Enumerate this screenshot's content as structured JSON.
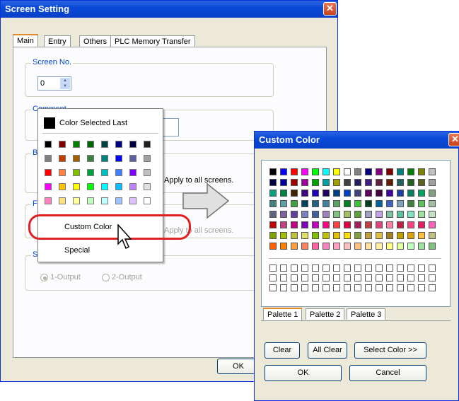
{
  "screen_setting": {
    "title": "Screen Setting",
    "close_glyph": "✕",
    "tabs": [
      "Main",
      "Entry",
      "Others",
      "PLC Memory Transfer"
    ],
    "screen_no": {
      "label": "Screen No.",
      "value": "0"
    },
    "comment": {
      "label": "Comment"
    },
    "group_b_letter": "B",
    "group_f_letter": "F",
    "group_s_letter": "S",
    "apply_all_1": "Apply to all screens.",
    "apply_all_2": "Apply to all screens.",
    "output_1": "1-Output",
    "output_2": "2-Output",
    "ok_label": "OK"
  },
  "color_menu": {
    "last_label": "Color Selected Last",
    "custom_label": "Custom Color",
    "special_label": "Special",
    "swatches": [
      [
        "#000000",
        "#800000",
        "#008000",
        "#006400",
        "#004040",
        "#000080",
        "#000040",
        "#202020"
      ],
      [
        "#808080",
        "#c04000",
        "#a06000",
        "#408040",
        "#008080",
        "#0000ff",
        "#6060a0",
        "#a0a0a0"
      ],
      [
        "#ff0000",
        "#ff8040",
        "#80c000",
        "#00a040",
        "#00c0c0",
        "#4080ff",
        "#8000ff",
        "#c0c0c0"
      ],
      [
        "#ff00ff",
        "#ffc000",
        "#ffff00",
        "#00ff00",
        "#00ffff",
        "#00c0ff",
        "#c080ff",
        "#e0e0e0"
      ],
      [
        "#ff80c0",
        "#ffe080",
        "#ffffa0",
        "#c0ffc0",
        "#c0ffff",
        "#a0c0ff",
        "#e0c0ff",
        "#ffffff"
      ]
    ]
  },
  "custom_color": {
    "title": "Custom Color",
    "close_glyph": "✕",
    "palette_rows": [
      [
        "#000000",
        "#0000ff",
        "#ff0000",
        "#ff00ff",
        "#00ff00",
        "#00ffff",
        "#ffff00",
        "#ffffff",
        "#808080",
        "#000080",
        "#800080",
        "#800000",
        "#008080",
        "#008000",
        "#808000",
        "#c0c0c0"
      ],
      [
        "#000040",
        "#0000a0",
        "#a00000",
        "#a000a0",
        "#00a000",
        "#00a0a0",
        "#a0a000",
        "#404040",
        "#202060",
        "#402080",
        "#602040",
        "#602000",
        "#206060",
        "#206020",
        "#606020",
        "#a0a0a0"
      ],
      [
        "#00a080",
        "#008040",
        "#402000",
        "#400080",
        "#2000c0",
        "#200060",
        "#004080",
        "#0040c0",
        "#404080",
        "#600060",
        "#400040",
        "#4000a0",
        "#2040a0",
        "#008060",
        "#00a060",
        "#80a080"
      ],
      [
        "#408080",
        "#60a0a0",
        "#40a040",
        "#004060",
        "#206080",
        "#4080a0",
        "#60a060",
        "#008020",
        "#40c040",
        "#004020",
        "#0060a0",
        "#4060c0",
        "#80a0c0",
        "#408040",
        "#60c060",
        "#a0c0a0"
      ],
      [
        "#606080",
        "#8060a0",
        "#6040a0",
        "#8080c0",
        "#4060a0",
        "#a080c0",
        "#80c080",
        "#a0c060",
        "#60a040",
        "#a0a0c0",
        "#c0a0e0",
        "#80c0a0",
        "#60c0a0",
        "#80e0c0",
        "#a0e0a0",
        "#c0e0c0"
      ],
      [
        "#c00000",
        "#c04080",
        "#c00080",
        "#8000c0",
        "#c000c0",
        "#ff0080",
        "#ff4040",
        "#e00040",
        "#a02060",
        "#c04040",
        "#e04080",
        "#ff80a0",
        "#c02040",
        "#ff4080",
        "#e02060",
        "#ff60c0"
      ],
      [
        "#80a000",
        "#a0c000",
        "#c0c040",
        "#e0e060",
        "#80c000",
        "#c0c000",
        "#e0c000",
        "#ffe000",
        "#80a040",
        "#c0a040",
        "#e0c040",
        "#a08020",
        "#c0a000",
        "#e0a000",
        "#ffc040",
        "#c0c080"
      ],
      [
        "#ff6000",
        "#ff8000",
        "#ffa040",
        "#ff8060",
        "#ff60a0",
        "#ff80c0",
        "#ffa0c0",
        "#ffc0c0",
        "#ffc080",
        "#ffe0a0",
        "#fff0a0",
        "#ffff80",
        "#e0ffa0",
        "#c0ffc0",
        "#a0e0a0",
        "#80c080"
      ]
    ],
    "palette_tabs": [
      "Palette 1",
      "Palette 2",
      "Palette 3"
    ],
    "clear_label": "Clear",
    "all_clear_label": "All Clear",
    "select_color_label": "Select Color >>",
    "ok_label": "OK",
    "cancel_label": "Cancel"
  },
  "colors": {
    "titlebar": "#0a4ad8",
    "highlight_ring": "#e02020"
  }
}
